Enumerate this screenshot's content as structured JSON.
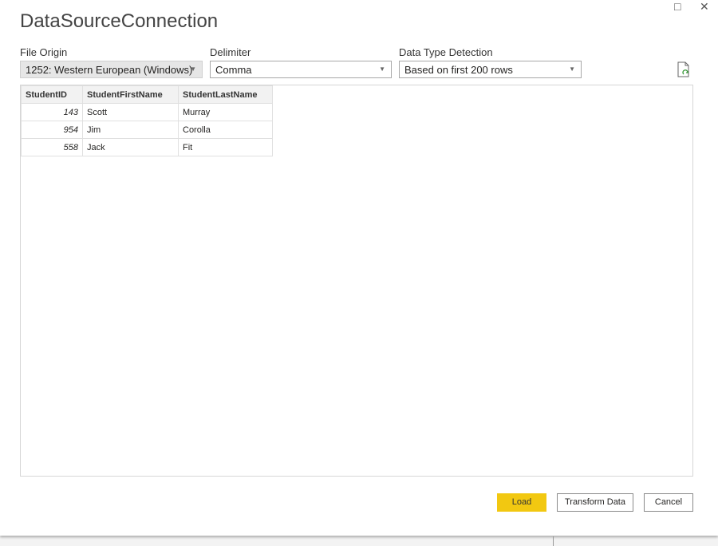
{
  "title": "DataSourceConnection",
  "window": {
    "maximize_icon": "□",
    "close_icon": "✕"
  },
  "file_origin": {
    "label": "File Origin",
    "value": "1252: Western European (Windows)"
  },
  "delimiter": {
    "label": "Delimiter",
    "value": "Comma"
  },
  "detection": {
    "label": "Data Type Detection",
    "value": "Based on first 200 rows"
  },
  "table": {
    "headers": [
      "StudentID",
      "StudentFirstName",
      "StudentLastName"
    ],
    "rows": [
      [
        "143",
        "Scott",
        "Murray"
      ],
      [
        "954",
        "Jim",
        "Corolla"
      ],
      [
        "558",
        "Jack",
        "Fit"
      ]
    ]
  },
  "buttons": {
    "load": "Load",
    "transform": "Transform Data",
    "cancel": "Cancel"
  },
  "colors": {
    "accent": "#f2c811"
  }
}
